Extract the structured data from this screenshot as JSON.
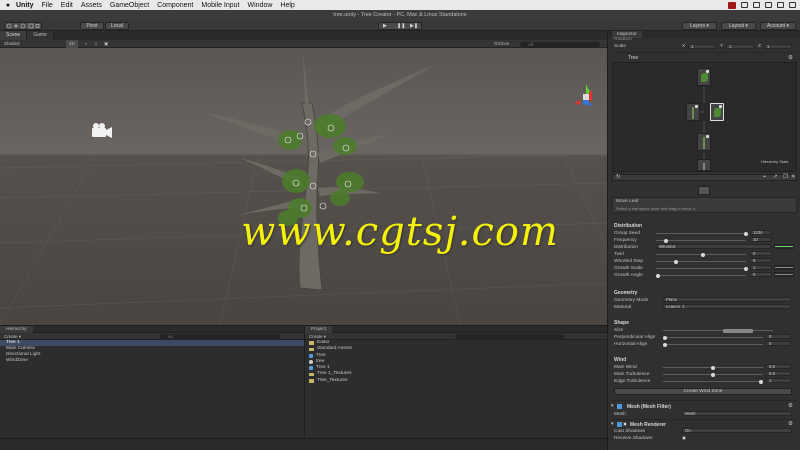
{
  "menubar": {
    "apple": "",
    "items": [
      "Unity",
      "File",
      "Edit",
      "Assets",
      "GameObject",
      "Component",
      "Mobile Input",
      "Window",
      "Help"
    ]
  },
  "window_title": "tree.unity - Tree Creator - PC, Mac & Linux Standalone",
  "toolbar": {
    "pivot": "Pivot",
    "local": "Local",
    "layers": "Layers",
    "layout": "Layout",
    "account": "Account"
  },
  "scene": {
    "tabs": [
      "Scene",
      "Game"
    ],
    "shading": "Shaded",
    "toggle_2d": "2D",
    "gizmos": "Gizmos",
    "search_all": "All"
  },
  "watermark": "www.cgtsj.com",
  "hierarchy": {
    "tab": "Hierarchy",
    "create": "Create",
    "search": "All",
    "items": [
      "Tree 1",
      "Main Camera",
      "Directional Light",
      "WindZone"
    ]
  },
  "project": {
    "tab": "Project",
    "create": "Create",
    "items": [
      {
        "label": "Editor",
        "kind": "folder"
      },
      {
        "label": "Standard Assets",
        "kind": "folder"
      },
      {
        "label": "Tree",
        "kind": "asset"
      },
      {
        "label": "tree",
        "kind": "scene"
      },
      {
        "label": "Tree 1",
        "kind": "asset"
      },
      {
        "label": "Tree 1_Textures",
        "kind": "folder"
      },
      {
        "label": "Tree_Textures",
        "kind": "folder"
      }
    ]
  },
  "inspector": {
    "tab": "Inspector",
    "rotation_label": "Rotation",
    "scale_label": "Scale",
    "scale_x": "1",
    "scale_y": "1",
    "scale_z": "1",
    "axis_x": "X",
    "axis_y": "Y",
    "axis_z": "Z",
    "tree_title": "Tree",
    "hierarchy_stats": "Hierarchy Stats",
    "move_leaf_title": "Move Leaf",
    "move_leaf_desc": "Select a leaf spline point and drag to move it.",
    "distribution": {
      "header": "Distribution",
      "group_seed_label": "Group Seed",
      "group_seed": "1234",
      "frequency_label": "Frequency",
      "frequency": "10",
      "distribution_label": "Distribution",
      "distribution_value": "Whorled",
      "twirl_label": "Twirl",
      "twirl": "0",
      "whorled_step_label": "Whorled Step",
      "whorled_step": "5",
      "growth_scale_label": "Growth Scale",
      "growth_scale": "1",
      "growth_angle_label": "Growth Angle",
      "growth_angle": "0"
    },
    "geometry": {
      "header": "Geometry",
      "mode_label": "Geometry Mode",
      "mode_value": "Plane",
      "material_label": "Material",
      "material_value": "Leaves_1"
    },
    "shape": {
      "header": "Shape",
      "size_label": "Size",
      "perp_label": "Perpendicular Align",
      "perp": "0",
      "horiz_label": "Horizontal Align",
      "horiz": "0"
    },
    "wind": {
      "header": "Wind",
      "main_wind_label": "Main Wind",
      "main_wind": "0.5",
      "main_turb_label": "Main Turbulence",
      "main_turb": "0.5",
      "edge_turb_label": "Edge Turbulence",
      "edge_turb": "1",
      "create_button": "Create Wind Zone"
    },
    "mesh_filter": {
      "title": "Mesh (Mesh Filter)",
      "mesh_label": "Mesh",
      "mesh_value": "Mesh"
    },
    "mesh_renderer": {
      "title": "Mesh Renderer",
      "cast_label": "Cast Shadows",
      "cast_value": "On",
      "receive_label": "Receive Shadows"
    }
  },
  "colors": {
    "accent": "#3c4b63",
    "watermark": "#f5f00a",
    "curve": "#5fd35f"
  }
}
